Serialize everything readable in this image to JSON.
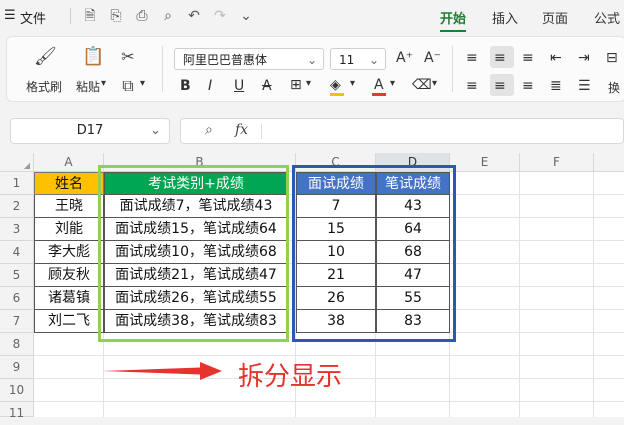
{
  "menubar": {
    "file_label": "文件",
    "tabs": [
      "开始",
      "插入",
      "页面",
      "公式"
    ],
    "active_tab": "开始"
  },
  "ribbon": {
    "format_painter": "格式刷",
    "paste": "粘贴",
    "font_name": "阿里巴巴普惠体",
    "font_size": "11",
    "wrap": "换"
  },
  "formula_bar": {
    "name_box": "D17",
    "fx_label": "fx",
    "content": ""
  },
  "columns": [
    "A",
    "B",
    "C",
    "D",
    "E",
    "F"
  ],
  "rows": [
    "1",
    "2",
    "3",
    "4",
    "5",
    "6",
    "7",
    "8",
    "9",
    "10",
    "11"
  ],
  "table": {
    "headers": {
      "name": "姓名",
      "combined": "考试类别+成绩",
      "interview": "面试成绩",
      "written": "笔试成绩"
    },
    "records": [
      {
        "name": "王晓",
        "combined": "面试成绩7，笔试成绩43",
        "interview": "7",
        "written": "43"
      },
      {
        "name": "刘能",
        "combined": "面试成绩15，笔试成绩64",
        "interview": "15",
        "written": "64"
      },
      {
        "name": "李大彪",
        "combined": "面试成绩10，笔试成绩68",
        "interview": "10",
        "written": "68"
      },
      {
        "name": "顾友秋",
        "combined": "面试成绩21，笔试成绩47",
        "interview": "21",
        "written": "47"
      },
      {
        "name": "诸葛镇",
        "combined": "面试成绩26，笔试成绩55",
        "interview": "26",
        "written": "55"
      },
      {
        "name": "刘二飞",
        "combined": "面试成绩38，笔试成绩83",
        "interview": "38",
        "written": "83"
      }
    ]
  },
  "annotation": {
    "text": "拆分显示"
  },
  "colors": {
    "name_header": "#ffc000",
    "combined_header": "#00a651",
    "score_header": "#4472c4",
    "green_box": "#92d050",
    "blue_box": "#2f55b7",
    "annotation": "#e8322d",
    "accent": "#1e7e34"
  }
}
